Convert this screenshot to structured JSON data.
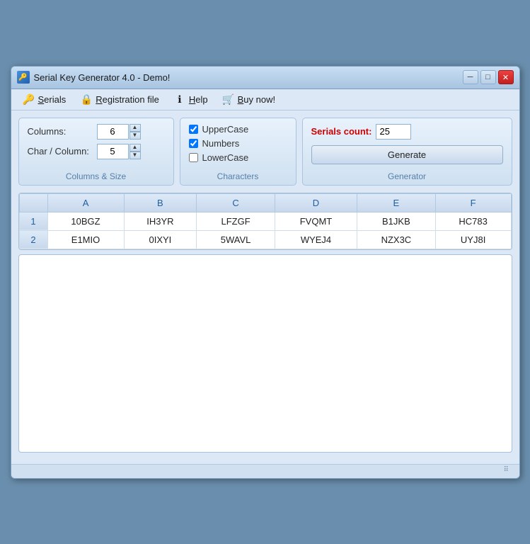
{
  "window": {
    "title": "Serial Key Generator 4.0 - Demo!",
    "title_icon": "🔑"
  },
  "title_controls": {
    "minimize_label": "─",
    "maximize_label": "□",
    "close_label": "✕"
  },
  "menu": {
    "items": [
      {
        "id": "serials",
        "icon": "🔑",
        "label": "Serials",
        "underline_start": 0
      },
      {
        "id": "registration",
        "icon": "🔒",
        "label": "Registration file",
        "underline_start": 0
      },
      {
        "id": "help",
        "icon": "ℹ",
        "label": "Help",
        "underline_start": 0
      },
      {
        "id": "buynow",
        "icon": "🛒",
        "label": "Buy now!",
        "underline_start": 0
      }
    ]
  },
  "columns_section": {
    "label": "Columns & Size",
    "columns_label": "Columns:",
    "columns_value": "6",
    "char_column_label": "Char / Column:",
    "char_column_value": "5"
  },
  "characters_section": {
    "label": "Characters",
    "uppercase_label": "UpperCase",
    "uppercase_checked": true,
    "numbers_label": "Numbers",
    "numbers_checked": true,
    "lowercase_label": "LowerCase",
    "lowercase_checked": false
  },
  "generator_section": {
    "label": "Generator",
    "serials_count_label": "Serials count:",
    "serials_count_value": "25",
    "generate_button_label": "Generate"
  },
  "table": {
    "headers": [
      "",
      "A",
      "B",
      "C",
      "D",
      "E",
      "F"
    ],
    "rows": [
      {
        "id": "1",
        "cells": [
          "10BGZ",
          "IH3YR",
          "LFZGF",
          "FVQMT",
          "B1JKB",
          "HC783"
        ]
      },
      {
        "id": "2",
        "cells": [
          "E1MIO",
          "0IXYI",
          "5WAVL",
          "WYEJ4",
          "NZX3C",
          "UYJ8I"
        ]
      }
    ]
  }
}
